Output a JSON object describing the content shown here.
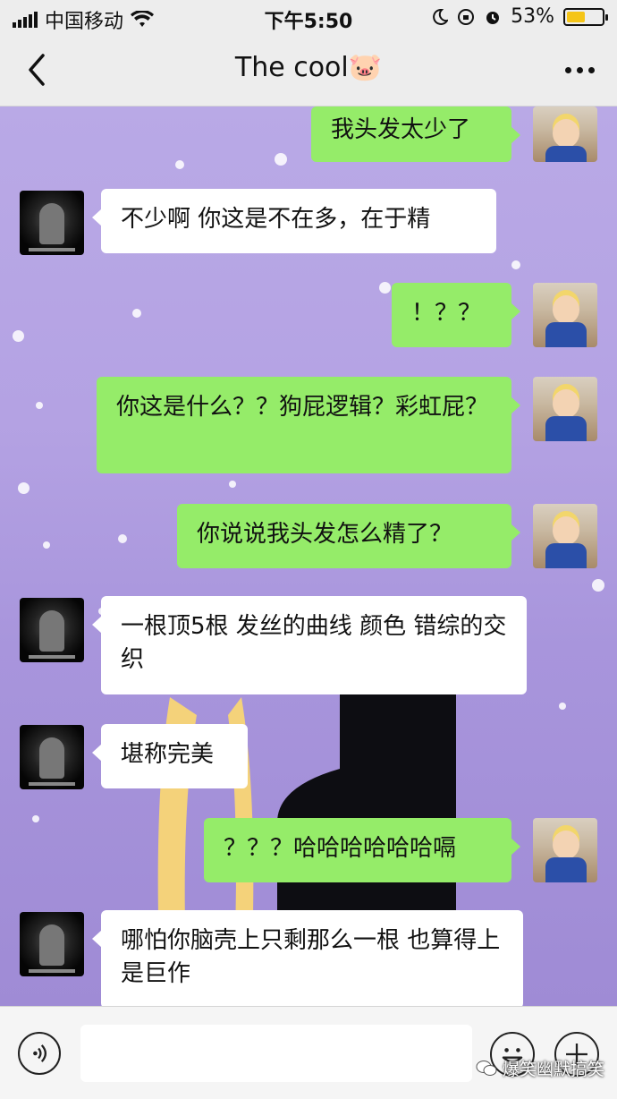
{
  "status_bar": {
    "carrier": "中国移动",
    "time": "下午5:50",
    "battery": "53%",
    "battery_level": 0.53
  },
  "header": {
    "title": "The cool🐷"
  },
  "messages": [
    {
      "side": "out",
      "text": "我头发太少了"
    },
    {
      "side": "in",
      "text": "不少啊 你这是不在多，在于精"
    },
    {
      "side": "out",
      "text": "！？？"
    },
    {
      "side": "out",
      "text": "你这是什么？？狗屁逻辑？彩虹屁？"
    },
    {
      "side": "out",
      "text": "你说说我头发怎么精了？"
    },
    {
      "side": "in",
      "text": "一根顶5根 发丝的曲线 颜色 错综的交织"
    },
    {
      "side": "in",
      "text": "堪称完美"
    },
    {
      "side": "out",
      "text": "？？？哈哈哈哈哈哈嗝"
    },
    {
      "side": "in",
      "text": "哪怕你脑壳上只剩那么一根 也算得上是巨作"
    }
  ],
  "watermark": "爆笑幽默搞笑",
  "icons": {
    "back": "chevron-left-icon",
    "more": "more-icon",
    "voice": "voice-icon",
    "emoji": "emoji-icon",
    "plus": "plus-icon"
  },
  "colors": {
    "outgoing_bubble": "#95ec69",
    "incoming_bubble": "#ffffff",
    "chrome": "#ededed"
  }
}
